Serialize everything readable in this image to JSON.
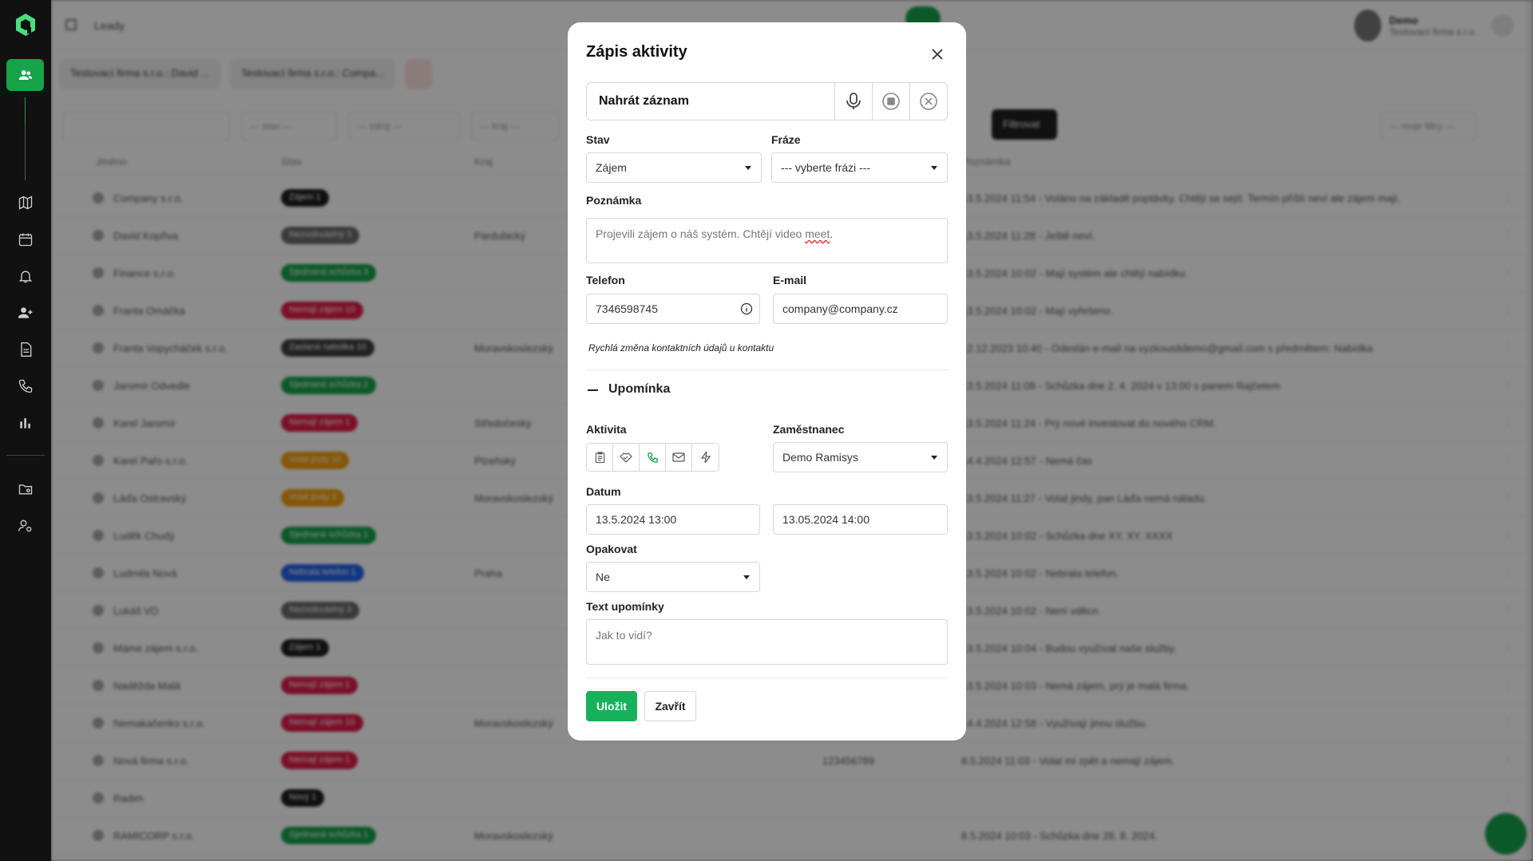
{
  "background": {
    "breadcrumb": "Leady",
    "user": {
      "name": "Demo",
      "subtitle": "Testovací firma s.r.o."
    },
    "filter_tabs": [
      "Testovací firma s.r.o.: David ...",
      "Testovací firma s.r.o.: Compa..."
    ],
    "filters": [
      "--- stav ---",
      "--- zdroj ---",
      "--- kraj ---"
    ],
    "filter_button": "Filtrovat",
    "filters_select": "--- moje filtry ---",
    "columns": [
      "Jméno",
      "Stav",
      "Kraj",
      "Poznámka"
    ],
    "rows": [
      {
        "name": "Company s.r.o.",
        "badge": "Zájem 1",
        "badge_color": "#1f1f1f",
        "region": "",
        "phone": "",
        "note": "13.5.2024 11:54 - Voláno na základě poptávky. Chtějí se sejít. Termín příští neví ale zájem mají."
      },
      {
        "name": "David Kopřiva",
        "badge": "Nezvolnutelný 3",
        "badge_color": "#6b6b6b",
        "region": "Pardubický",
        "phone": "",
        "note": "13.5.2024 11:28 - Ještě neví."
      },
      {
        "name": "Finance s.r.o.",
        "badge": "Sjednaná schůzka 3",
        "badge_color": "#16a34a",
        "region": "",
        "phone": "",
        "note": "13.5.2024 10:02 - Mají systém ale chtějí nabídku."
      },
      {
        "name": "Franta Omáčka",
        "badge": "Nemají zájem 10",
        "badge_color": "#e11d48",
        "region": "",
        "phone": "",
        "note": "13.5.2024 10:02 - Mají vyřešeno."
      },
      {
        "name": "Franta Vopycháček s.r.o.",
        "badge": "Zaslaná nabídka 10",
        "badge_color": "#3f3f3f",
        "region": "Moravskoslezský",
        "phone": "",
        "note": "12.12.2023 10:40 - Odeslán e-mail na vyzkousitdemo@gmail.com s předmětem: Nabídka"
      },
      {
        "name": "Jaromír Odvedle",
        "badge": "Sjednaná schůzka 2",
        "badge_color": "#16a34a",
        "region": "",
        "phone": "",
        "note": "13.5.2024 11:08 - Schůzka dne 2. 4. 2024 v 13:00 s panem Rajčetem"
      },
      {
        "name": "Karel Jaromír",
        "badge": "Nemají zájem 1",
        "badge_color": "#e11d48",
        "region": "Středočeský",
        "phone": "",
        "note": "13.5.2024 11:24 - Prý nové investovat do nového CRM."
      },
      {
        "name": "Karel Pařo s.r.o.",
        "badge": "Volat jindy 10",
        "badge_color": "#f59e0b",
        "region": "Plzeňský",
        "phone": "",
        "note": "14.4.2024 12:57 - Nemá čas"
      },
      {
        "name": "Láďa Ostravský",
        "badge": "Volat jindy 3",
        "badge_color": "#f59e0b",
        "region": "Moravskoslezský",
        "phone": "",
        "note": "13.5.2024 11:27 - Volat jindy, pan Láďa nemá náladu."
      },
      {
        "name": "Luděk Chudý",
        "badge": "Sjednaná schůzka 1",
        "badge_color": "#16a34a",
        "region": "",
        "phone": "",
        "note": "13.5.2024 10:02 - Schůzka dne XY. XY. XXXX"
      },
      {
        "name": "Ludmila Nová",
        "badge": "Nebrala telefon 1",
        "badge_color": "#2563eb",
        "region": "Praha",
        "phone": "",
        "note": "13.5.2024 10:02 - Nebrala telefon."
      },
      {
        "name": "Lukáš VD",
        "badge": "Nezvolnutelný 3",
        "badge_color": "#6b6b6b",
        "region": "",
        "phone": "",
        "note": "13.5.2024 10:02 - Není vděcn."
      },
      {
        "name": "Máme zájem s.r.o.",
        "badge": "Zájem 1",
        "badge_color": "#1f1f1f",
        "region": "",
        "phone": "",
        "note": "13.5.2024 10:04 - Budou využívat naše služby."
      },
      {
        "name": "Naděžda Malá",
        "badge": "Nemají zájem 1",
        "badge_color": "#e11d48",
        "region": "",
        "phone": "",
        "note": "13.5.2024 10:03 - Nemá zájem, prý je malá firma."
      },
      {
        "name": "Nemakačenko s.r.o.",
        "badge": "Nemají zájem 10",
        "badge_color": "#e11d48",
        "region": "Moravskoslezský",
        "phone": "",
        "note": "14.4.2024 12:58 - Využívají jinou službu."
      },
      {
        "name": "Nová firma s.r.o.",
        "badge": "Nemají zájem 1",
        "badge_color": "#e11d48",
        "region": "",
        "phone": "123456789",
        "note": "8.5.2024 11:03 - Volat mi zpět a nemají zájem."
      },
      {
        "name": "Radim",
        "badge": "Nový 1",
        "badge_color": "#1f1f1f",
        "region": "",
        "phone": "",
        "note": ""
      },
      {
        "name": "RAMICORP s.r.o.",
        "badge": "Sjednaná schůzka 1",
        "badge_color": "#16a34a",
        "region": "Moravskoslezský",
        "phone": "",
        "note": "8.5.2024 10:03 - Schůzka dne 28. 8. 2024."
      }
    ]
  },
  "modal": {
    "title": "Zápis aktivity",
    "record_label": "Nahrát záznam",
    "status": {
      "label": "Stav",
      "value": "Zájem"
    },
    "phrase": {
      "label": "Fráze",
      "value": "--- vyberte frázi ---"
    },
    "note": {
      "label": "Poznámka",
      "text": "Projevili zájem o náš systém. Chtějí video ",
      "spellword": "meet",
      "tail": "."
    },
    "phone": {
      "label": "Telefon",
      "value": "7346598745"
    },
    "email": {
      "label": "E-mail",
      "value": "company@company.cz"
    },
    "hint": "Rychlá změna kontaktních údajů u kontaktu",
    "reminder_title": "Upomínka",
    "activity_label": "Aktivita",
    "employee": {
      "label": "Zaměstnanec",
      "value": "Demo Ramisys"
    },
    "date": {
      "label": "Datum",
      "from": "13.5.2024 13:00",
      "to": "13.05.2024 14:00"
    },
    "repeat": {
      "label": "Opakovat",
      "value": "Ne"
    },
    "reminder_text": {
      "label": "Text upomínky",
      "placeholder": "Jak to vidí?"
    },
    "save": "Uložit",
    "close": "Zavřít",
    "accent_color": "#16b15a"
  }
}
